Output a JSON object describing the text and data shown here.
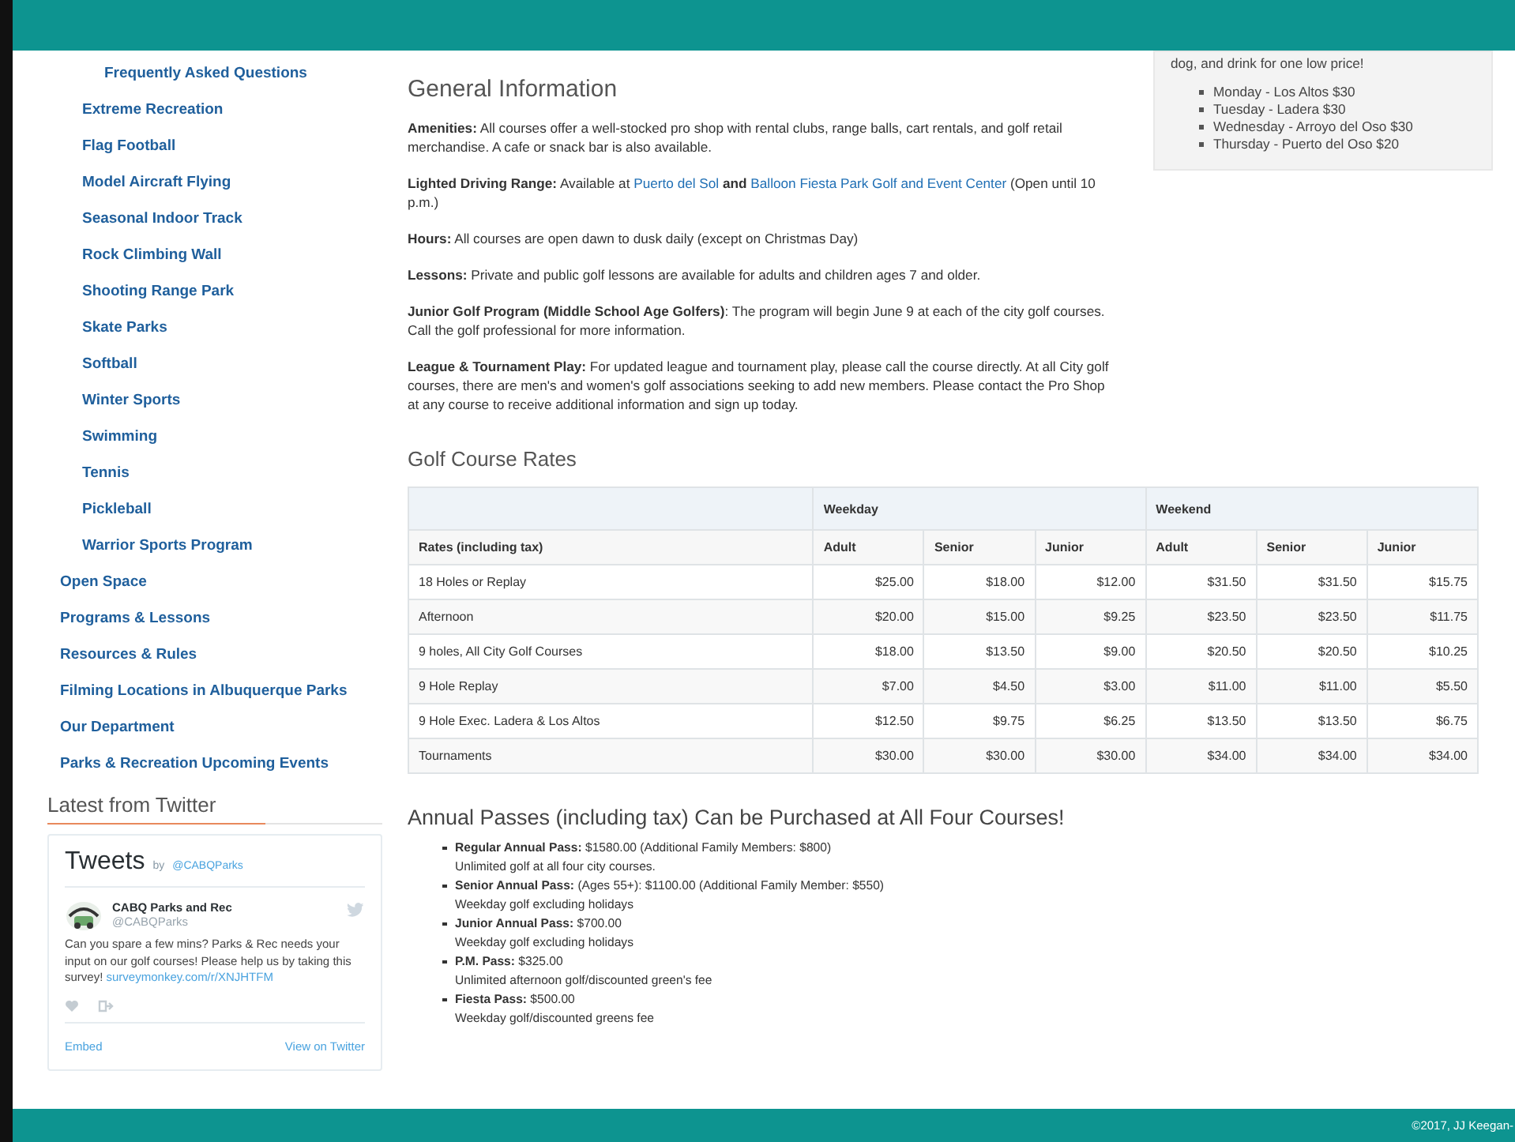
{
  "sidebar": {
    "items": [
      {
        "children": [
          {
            "children": [
              {
                "label": "Frequently Asked Questions"
              }
            ]
          },
          {
            "label": "Extreme Recreation"
          },
          {
            "label": "Flag Football"
          },
          {
            "label": "Model Aircraft Flying"
          },
          {
            "label": "Seasonal Indoor Track"
          },
          {
            "label": "Rock Climbing Wall"
          },
          {
            "label": "Shooting Range Park"
          },
          {
            "label": "Skate Parks"
          },
          {
            "label": "Softball"
          },
          {
            "label": "Winter Sports"
          },
          {
            "label": "Swimming"
          },
          {
            "label": "Tennis"
          },
          {
            "label": "Pickleball"
          },
          {
            "label": "Warrior Sports Program"
          }
        ]
      },
      {
        "label": "Open Space"
      },
      {
        "label": "Programs & Lessons"
      },
      {
        "label": "Resources & Rules"
      },
      {
        "label": "Filming Locations in Albuquerque Parks"
      },
      {
        "label": "Our Department"
      },
      {
        "label": "Parks & Recreation Upcoming Events"
      }
    ]
  },
  "twitter": {
    "heading": "Latest from Twitter",
    "title": "Tweets",
    "by": "by",
    "handle_link": "@CABQParks",
    "tweet": {
      "name": "CABQ Parks and Rec",
      "handle": "@CABQParks",
      "text": "Can you spare a few mins? Parks & Rec needs your input on our golf courses! Please help us by taking this survey!",
      "link": "surveymonkey.com/r/XNJHTFM"
    },
    "footer_links": [
      "Embed",
      "View on Twitter"
    ]
  },
  "general": {
    "title": "General Information",
    "paragraphs": [
      {
        "parts": [
          {
            "kind": "text",
            "text": "**Amenities:** All courses offer a well-stocked pro shop with rental clubs, range balls, cart rentals, and golf retail merchandise. A cafe or snack bar is also available."
          }
        ]
      },
      {
        "parts": [
          {
            "kind": "text",
            "text": "**Lighted Driving Range:** Available at "
          },
          {
            "kind": "link",
            "text": "Puerto del Sol"
          },
          {
            "kind": "text",
            "text": " **and** "
          },
          {
            "kind": "link",
            "text": "Balloon Fiesta Park Golf and Event Center"
          },
          {
            "kind": "text",
            "text": " (Open until 10 p.m.)"
          }
        ]
      },
      {
        "parts": [
          {
            "kind": "text",
            "text": "**Hours:** All courses are open dawn to dusk daily (except on Christmas Day)"
          }
        ]
      },
      {
        "parts": [
          {
            "kind": "text",
            "text": "**Lessons:** Private and public golf lessons are available for adults and children ages 7 and older."
          }
        ]
      },
      {
        "parts": [
          {
            "kind": "text",
            "text": "**Junior Golf Program (Middle School Age Golfers)**: The program will begin June 9 at each of the city golf courses. Call the golf professional for more information."
          }
        ]
      },
      {
        "parts": [
          {
            "kind": "text",
            "text": "**League & Tournament Play:** For updated league and tournament play, please call the course directly. At all City golf courses, there are men's and women's golf associations seeking to add new members. Please contact the Pro Shop at any course to receive additional information and sign up today."
          }
        ]
      }
    ]
  },
  "promo": {
    "text": "dog, and drink for one low price!",
    "items": [
      "Monday - Los Altos $30",
      "Tuesday - Ladera $30",
      "Wednesday - Arroyo del Oso $30",
      "Thursday - Puerto del Oso $20"
    ]
  },
  "rates": {
    "title": "Golf Course Rates",
    "groups": [
      "Weekday",
      "Weekend"
    ],
    "columns": [
      "Rates (including tax)",
      "Adult",
      "Senior",
      "Junior",
      "Adult",
      "Senior",
      "Junior"
    ],
    "rows": [
      [
        "18 Holes or Replay",
        "$25.00",
        "$18.00",
        "$12.00",
        "$31.50",
        "$31.50",
        "$15.75"
      ],
      [
        "Afternoon",
        "$20.00",
        "$15.00",
        "$9.25",
        "$23.50",
        "$23.50",
        "$11.75"
      ],
      [
        "9 holes, All City Golf Courses",
        "$18.00",
        "$13.50",
        "$9.00",
        "$20.50",
        "$20.50",
        "$10.25"
      ],
      [
        "9 Hole Replay",
        "$7.00",
        "$4.50",
        "$3.00",
        "$11.00",
        "$11.00",
        "$5.50"
      ],
      [
        "9 Hole Exec. Ladera & Los Altos",
        "$12.50",
        "$9.75",
        "$6.25",
        "$13.50",
        "$13.50",
        "$6.75"
      ],
      [
        "Tournaments",
        "$30.00",
        "$30.00",
        "$30.00",
        "$34.00",
        "$34.00",
        "$34.00"
      ]
    ]
  },
  "passes": {
    "title": "Annual Passes (including tax) Can be Purchased at All Four Courses!",
    "items": [
      {
        "line": "**Regular Annual Pass:** $1580.00 (Additional Family Members: $800)",
        "note": "Unlimited golf at all four city courses."
      },
      {
        "line": "**Senior Annual Pass:** (Ages 55+): $1100.00 (Additional Family Member: $550)",
        "note": "Weekday golf excluding holidays"
      },
      {
        "line": "**Junior Annual Pass:** $700.00",
        "note": "Weekday golf excluding holidays"
      },
      {
        "line": "**P.M. Pass:** $325.00",
        "note": "Unlimited afternoon golf/discounted green's fee"
      },
      {
        "line": "**Fiesta Pass:** $500.00",
        "note": "Weekday golf/discounted greens fee"
      }
    ]
  },
  "footer": {
    "text": "©2017, JJ Keegan-"
  }
}
